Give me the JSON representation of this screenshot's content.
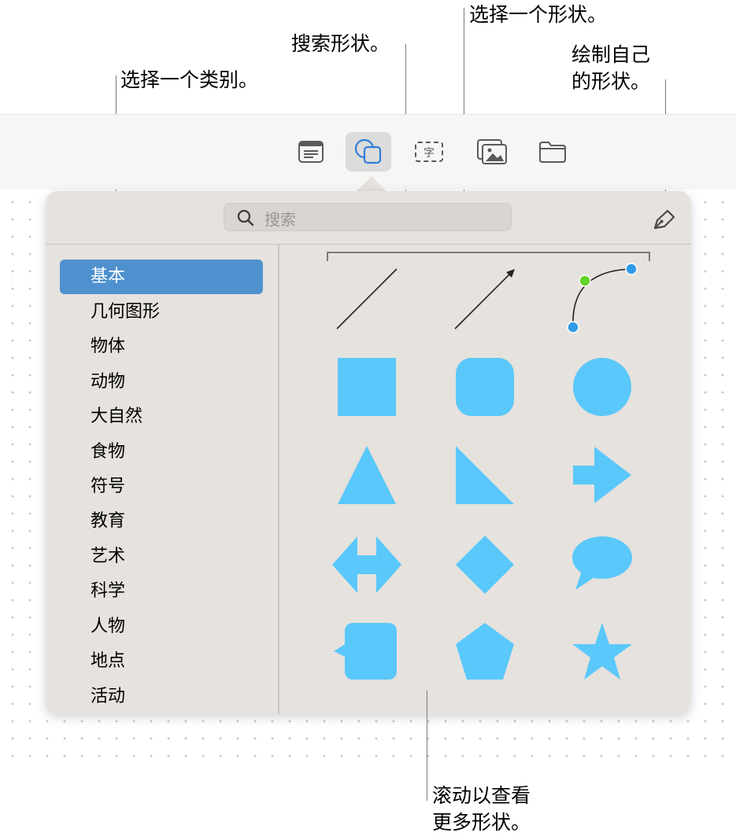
{
  "callouts": {
    "select_category": "选择一个类别。",
    "search_shapes": "搜索形状。",
    "select_shape": "选择一个形状。",
    "draw_line1": "绘制自己",
    "draw_line2": "的形状。",
    "scroll_line1": "滚动以查看",
    "scroll_line2": "更多形状。"
  },
  "toolbar": {
    "buttons": [
      {
        "icon": "text-box-icon",
        "active": false
      },
      {
        "icon": "shapes-icon",
        "active": true
      },
      {
        "icon": "text-icon",
        "glyph": "字",
        "active": false
      },
      {
        "icon": "media-icon",
        "active": false
      },
      {
        "icon": "folder-icon",
        "active": false
      }
    ]
  },
  "search": {
    "placeholder": "搜索"
  },
  "categories": [
    "基本",
    "几何图形",
    "物体",
    "动物",
    "大自然",
    "食物",
    "符号",
    "教育",
    "艺术",
    "科学",
    "人物",
    "地点",
    "活动"
  ],
  "selected_category": "基本",
  "shapes": [
    "line",
    "arrow-line",
    "curve",
    "square",
    "rounded-square",
    "circle",
    "triangle",
    "right-triangle",
    "arrow",
    "double-arrow",
    "diamond",
    "speech-bubble",
    "callout-square",
    "pentagon",
    "star"
  ],
  "colors": {
    "shape_fill": "#5ac8fa",
    "selection": "#4f91ce",
    "curve_start": "#64d32a",
    "curve_handle": "#2f9be6"
  }
}
